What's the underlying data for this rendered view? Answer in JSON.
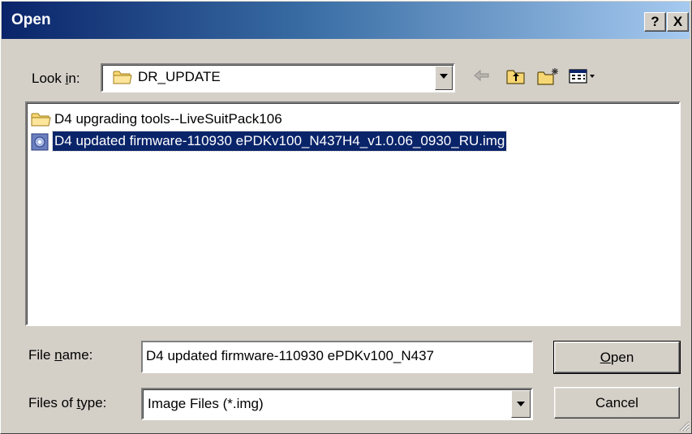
{
  "window": {
    "title": "Open",
    "help_label": "?",
    "close_label": "X"
  },
  "look_in": {
    "label_pre": "Look ",
    "label_key": "i",
    "label_post": "n:",
    "value": "DR_UPDATE",
    "folder_icon": "folder-icon"
  },
  "toolbar": {
    "back_icon": "back-arrow-icon",
    "up_icon": "up-one-level-icon",
    "new_folder_icon": "new-folder-icon",
    "view_icon": "view-menu-icon"
  },
  "files": [
    {
      "name": "D4 upgrading tools--LiveSuitPack106",
      "icon": "folder-icon",
      "selected": false
    },
    {
      "name": "D4 updated firmware-110930  ePDKv100_N437H4_v1.0.06_0930_RU.img",
      "icon": "disc-image-icon",
      "selected": true
    }
  ],
  "file_name": {
    "label_pre": "File ",
    "label_key": "n",
    "label_post": "ame:",
    "value": "D4 updated firmware-110930  ePDKv100_N437"
  },
  "file_type": {
    "label_pre": "Files of ",
    "label_key": "t",
    "label_post": "ype:",
    "value": "Image Files (*.img)"
  },
  "buttons": {
    "open_key": "O",
    "open_rest": "pen",
    "cancel": "Cancel"
  },
  "colors": {
    "titlebar_start": "#0a246a",
    "titlebar_end": "#a6caf0",
    "selection": "#0a246a",
    "face": "#d4d0c8"
  }
}
